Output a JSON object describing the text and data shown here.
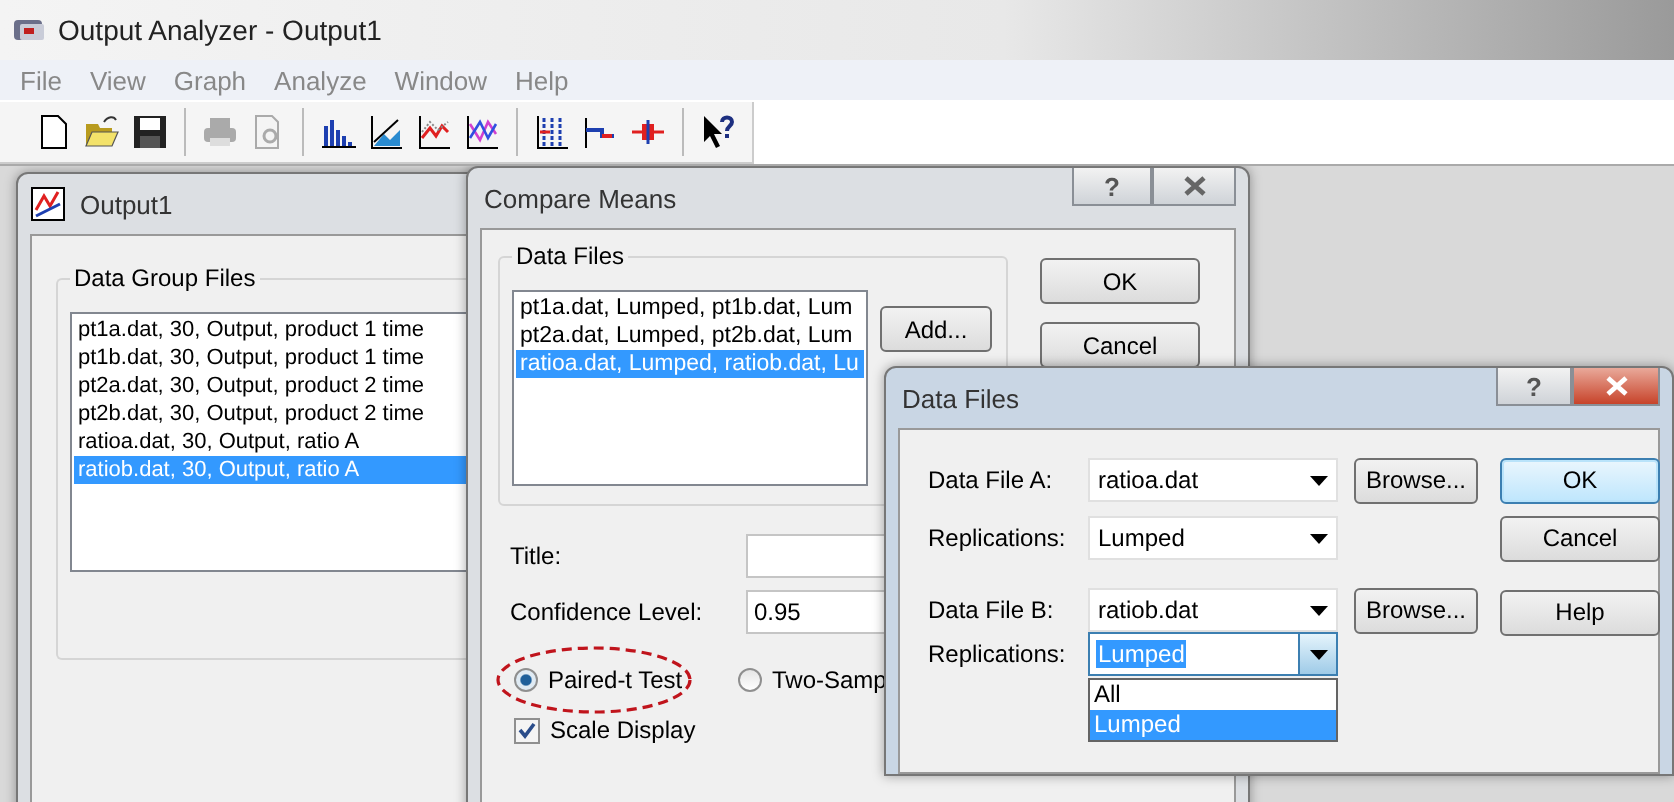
{
  "window": {
    "title": "Output Analyzer - Output1"
  },
  "menu": [
    "File",
    "View",
    "Graph",
    "Analyze",
    "Window",
    "Help"
  ],
  "toolbar": [
    {
      "kind": "new",
      "disabled": false
    },
    {
      "kind": "open",
      "disabled": false
    },
    {
      "kind": "save",
      "disabled": false
    },
    {
      "kind": "separator"
    },
    {
      "kind": "print",
      "disabled": true
    },
    {
      "kind": "preview",
      "disabled": true
    },
    {
      "kind": "separator"
    },
    {
      "kind": "histogram",
      "disabled": false
    },
    {
      "kind": "area",
      "disabled": false
    },
    {
      "kind": "line",
      "disabled": false
    },
    {
      "kind": "lines",
      "disabled": false
    },
    {
      "kind": "separator"
    },
    {
      "kind": "bars",
      "disabled": false
    },
    {
      "kind": "step",
      "disabled": false
    },
    {
      "kind": "interval",
      "disabled": false
    },
    {
      "kind": "separator"
    },
    {
      "kind": "help",
      "disabled": false
    }
  ],
  "output_window": {
    "title": "Output1",
    "group_label": "Data Group Files",
    "files": [
      {
        "text": "pt1a.dat, 30, Output, product 1 time",
        "selected": false
      },
      {
        "text": "pt1b.dat, 30, Output, product 1 time",
        "selected": false
      },
      {
        "text": "pt2a.dat, 30, Output, product 2 time",
        "selected": false
      },
      {
        "text": "pt2b.dat, 30, Output, product 2 time",
        "selected": false
      },
      {
        "text": "ratioa.dat, 30, Output, ratio A",
        "selected": false
      },
      {
        "text": "ratiob.dat, 30, Output, ratio A",
        "selected": true
      }
    ]
  },
  "compare_means": {
    "title": "Compare Means",
    "help_glyph": "?",
    "group_label": "Data Files",
    "items": [
      {
        "text": "pt1a.dat, Lumped, pt1b.dat, Lum",
        "selected": false
      },
      {
        "text": "pt2a.dat, Lumped, pt2b.dat, Lum",
        "selected": false
      },
      {
        "text": "ratioa.dat, Lumped, ratiob.dat, Lu",
        "selected": true
      }
    ],
    "add_button": "Add...",
    "ok_button": "OK",
    "cancel_button": "Cancel",
    "title_label": "Title:",
    "confidence_label": "Confidence Level:",
    "confidence_value": "0.95",
    "test_options": [
      {
        "label": "Paired-t Test",
        "selected": true,
        "highlighted": true
      },
      {
        "label": "Two-Samp",
        "selected": false,
        "highlighted": false
      }
    ],
    "scale_display": {
      "label": "Scale Display",
      "checked": true
    }
  },
  "data_files": {
    "title": "Data Files",
    "help_glyph": "?",
    "rows": [
      {
        "label": "Data File A:",
        "value": "ratioa.dat",
        "button": "Browse...",
        "focused": false
      },
      {
        "label": "Replications:",
        "value": "Lumped",
        "focused": false
      },
      {
        "label": "Data File B:",
        "value": "ratiob.dat",
        "button": "Browse...",
        "focused": false
      },
      {
        "label": "Replications:",
        "value": "Lumped",
        "focused": true,
        "options": [
          {
            "label": "All",
            "selected": false
          },
          {
            "label": "Lumped",
            "selected": true
          }
        ]
      }
    ],
    "buttons": [
      {
        "label": "OK",
        "default": true
      },
      {
        "label": "Cancel",
        "default": false
      },
      {
        "label": "Help",
        "default": false
      }
    ]
  }
}
